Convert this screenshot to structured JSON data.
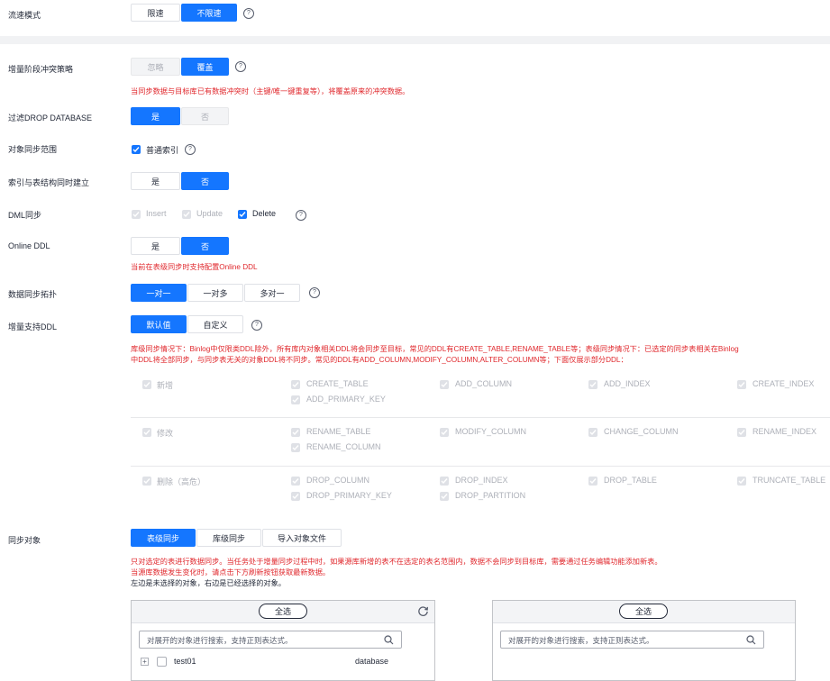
{
  "rate_limit": {
    "label": "流速模式",
    "options": [
      "限速",
      "不限速"
    ],
    "selected": 1
  },
  "conflict": {
    "label": "增量阶段冲突策略",
    "options": [
      "忽略",
      "覆盖"
    ],
    "selected": 1,
    "hint": "当同步数据与目标库已有数据冲突时（主键/唯一键重复等），将覆盖原来的冲突数据。"
  },
  "filter_drop": {
    "label": "过滤DROP DATABASE",
    "options": [
      "是",
      "否"
    ],
    "selected": 0
  },
  "sync_scope": {
    "label": "对象同步范围",
    "checkbox_label": "普通索引",
    "checked": true
  },
  "index_build": {
    "label": "索引与表结构同时建立",
    "options": [
      "是",
      "否"
    ],
    "selected": 1
  },
  "dml": {
    "label": "DML同步",
    "items": [
      {
        "label": "Insert",
        "state": "disabled"
      },
      {
        "label": "Update",
        "state": "disabled"
      },
      {
        "label": "Delete",
        "state": "checked"
      }
    ]
  },
  "online_ddl": {
    "label": "Online DDL",
    "options": [
      "是",
      "否"
    ],
    "selected": 1,
    "hint": "当前在表级同步时支持配置Online DDL"
  },
  "topology": {
    "label": "数据同步拓扑",
    "options": [
      "一对一",
      "一对多",
      "多对一"
    ],
    "selected": 0
  },
  "ddl": {
    "label": "增量支持DDL",
    "options": [
      "默认值",
      "自定义"
    ],
    "selected": 0,
    "hint_line1": "库级同步情况下：Binlog中仅限类DDL除外，所有库内对象相关DDL将会同步至目标，常见的DDL有CREATE_TABLE,RENAME_TABLE等；表级同步情况下：已选定的同步表相关在Binlog",
    "hint_line2": "中DDL将全部同步，与同步表无关的对象DDL将不同步。常见的DDL有ADD_COLUMN,MODIFY_COLUMN,ALTER_COLUMN等；下面仅展示部分DDL：",
    "groups": [
      {
        "category": "新增",
        "col1": [
          "CREATE_TABLE",
          "ADD_PRIMARY_KEY"
        ],
        "col2": [
          "ADD_COLUMN"
        ],
        "col3": [
          "ADD_INDEX"
        ],
        "col4": [
          "CREATE_INDEX"
        ]
      },
      {
        "category": "修改",
        "col1": [
          "RENAME_TABLE",
          "RENAME_COLUMN"
        ],
        "col2": [
          "MODIFY_COLUMN"
        ],
        "col3": [
          "CHANGE_COLUMN"
        ],
        "col4": [
          "RENAME_INDEX"
        ]
      },
      {
        "category": "删除（高危）",
        "col1": [
          "DROP_COLUMN",
          "DROP_PRIMARY_KEY"
        ],
        "col2": [
          "DROP_INDEX",
          "DROP_PARTITION"
        ],
        "col3": [
          "DROP_TABLE"
        ],
        "col4": [
          "TRUNCATE_TABLE"
        ]
      }
    ]
  },
  "sync_objects": {
    "label": "同步对象",
    "options": [
      "表级同步",
      "库级同步",
      "导入对象文件"
    ],
    "selected": 0,
    "hint_line1": "只对选定的表进行数据同步。当任务处于增量同步过程中时，如果源库新增的表不在选定的表名范围内，数据不会同步到目标库，需要通过任务编辑功能添加新表。",
    "hint_line2": "当源库数据发生变化时，请点击下方刷新按钮获取最新数据。",
    "note": "左边是未选择的对象，右边是已经选择的对象。",
    "left_panel": {
      "all_label": "全选",
      "search_placeholder": "对展开的对象进行搜索，支持正则表达式。",
      "rows": [
        {
          "name": "test01",
          "type": "database"
        }
      ]
    },
    "right_panel": {
      "all_label": "全选",
      "search_placeholder": "对展开的对象进行搜索，支持正则表达式。"
    }
  },
  "colors": {
    "primary": "#1476ff",
    "error": "#e0282d",
    "disabled": "#adb0b8"
  }
}
